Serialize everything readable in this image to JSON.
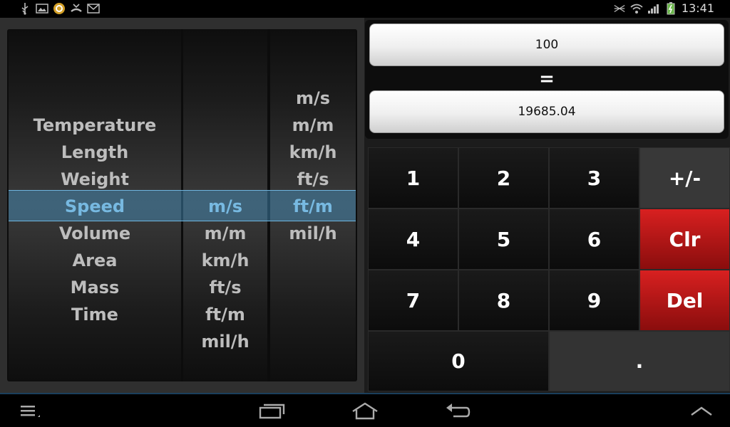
{
  "status_bar": {
    "left_icons": [
      "usb-icon",
      "image-icon",
      "sync-icon",
      "missed-call-icon",
      "mail-icon"
    ],
    "right_icons": [
      "nfc-icon",
      "wifi-icon",
      "signal-icon",
      "battery-icon"
    ],
    "time": "13:41"
  },
  "picker": {
    "type_column": [
      "Temperature",
      "Length",
      "Weight",
      "Speed",
      "Volume",
      "Area",
      "Mass",
      "Time"
    ],
    "type_selected": "Speed",
    "from_column": [
      "m/s",
      "m/m",
      "km/h",
      "ft/s",
      "ft/m",
      "mil/h"
    ],
    "from_selected": "m/s",
    "to_column": [
      "m/s",
      "m/m",
      "km/h",
      "ft/s",
      "ft/m",
      "mil/h"
    ],
    "to_selected": "ft/m"
  },
  "display": {
    "input_value": "100",
    "equals_sign": "=",
    "result_value": "19685.04"
  },
  "keypad": {
    "k1": "1",
    "k2": "2",
    "k3": "3",
    "plusminus": "+/-",
    "k4": "4",
    "k5": "5",
    "k6": "6",
    "clear": "Clr",
    "k7": "7",
    "k8": "8",
    "k9": "9",
    "delete": "Del",
    "k0": "0",
    "dot": "."
  },
  "colors": {
    "selection": "#4696c8",
    "red_key": "#d82020",
    "gray_key": "#383838"
  },
  "nav_bar": {
    "icons": [
      "menu-icon",
      "recent-apps-icon",
      "home-icon",
      "back-icon",
      "expand-icon"
    ]
  }
}
